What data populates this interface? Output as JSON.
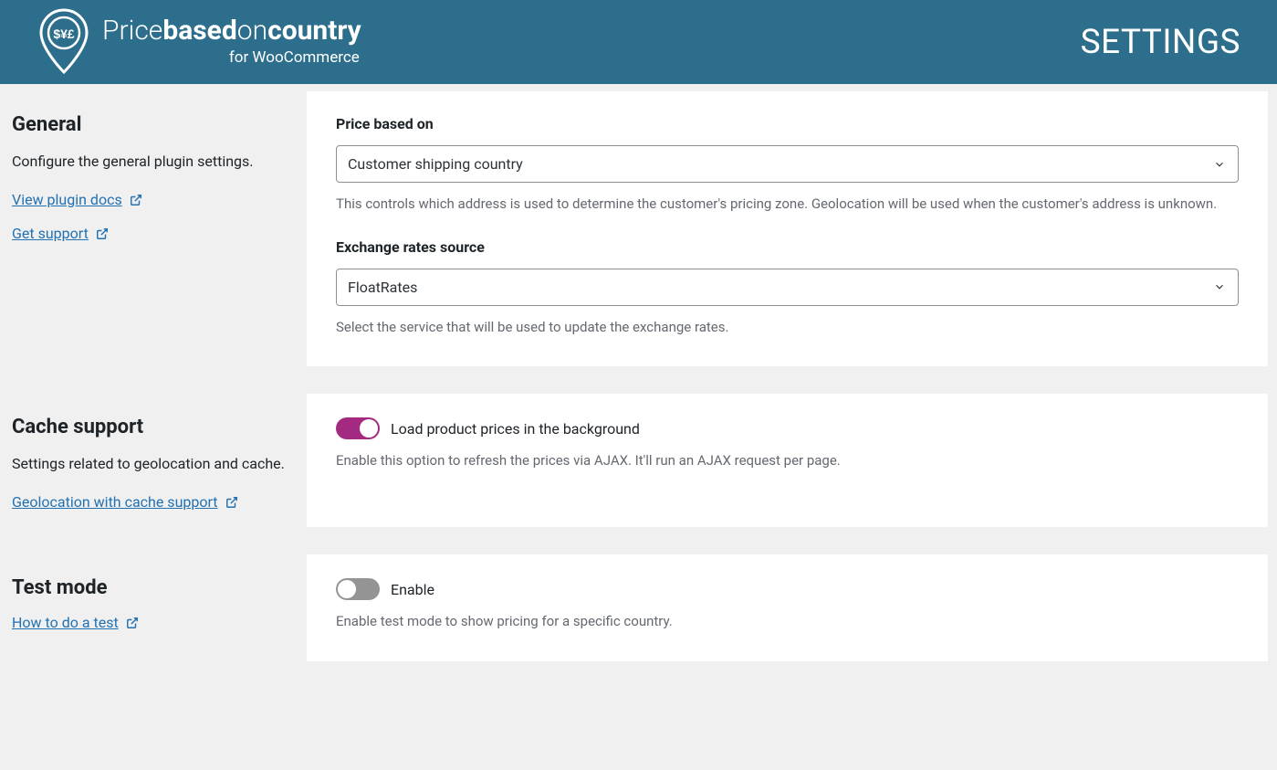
{
  "header": {
    "logo_top_light": "Price",
    "logo_top_bold1": "based",
    "logo_top_light2": "on",
    "logo_top_bold2": "country",
    "logo_bottom": "for WooCommerce",
    "title": "SETTINGS"
  },
  "sections": {
    "general": {
      "title": "General",
      "description": "Configure the general plugin settings.",
      "links": [
        {
          "label": "View plugin docs"
        },
        {
          "label": "Get support"
        }
      ],
      "fields": {
        "price_based_on": {
          "label": "Price based on",
          "value": "Customer shipping country",
          "helper": "This controls which address is used to determine the customer's pricing zone. Geolocation will be used when the customer's address is unknown."
        },
        "exchange_rates": {
          "label": "Exchange rates source",
          "value": "FloatRates",
          "helper": "Select the service that will be used to update the exchange rates."
        }
      }
    },
    "cache": {
      "title": "Cache support",
      "description": "Settings related to geolocation and cache.",
      "links": [
        {
          "label": "Geolocation with cache support"
        }
      ],
      "toggle": {
        "label": "Load product prices in the background",
        "helper": "Enable this option to refresh the prices via AJAX. It'll run an AJAX request per page.",
        "on": true
      }
    },
    "testmode": {
      "title": "Test mode",
      "links": [
        {
          "label": "How to do a test"
        }
      ],
      "toggle": {
        "label": "Enable",
        "helper": "Enable test mode to show pricing for a specific country.",
        "on": false
      }
    }
  }
}
